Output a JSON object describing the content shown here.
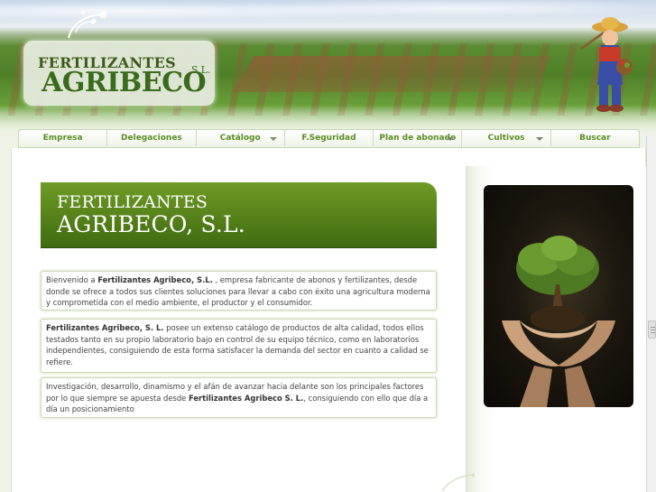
{
  "brand": {
    "logo_line1": "FERTILIZANTES",
    "logo_line2": "AGRIBECO",
    "logo_suffix": "S.L."
  },
  "nav": {
    "items": [
      {
        "label": "Empresa",
        "has_dropdown": false
      },
      {
        "label": "Delegaciones",
        "has_dropdown": false
      },
      {
        "label": "Catálogo",
        "has_dropdown": true
      },
      {
        "label": "F.Seguridad",
        "has_dropdown": false
      },
      {
        "label": "Plan de abonado",
        "has_dropdown": true
      },
      {
        "label": "Cultivos",
        "has_dropdown": true
      },
      {
        "label": "Buscar",
        "has_dropdown": false
      }
    ]
  },
  "main": {
    "title_line1": "FERTILIZANTES",
    "title_line2": "AGRIBECO, S.L.",
    "paragraphs": [
      {
        "pre": "Bienvenido a ",
        "bold": "Fertilizantes Agribeco, S.L.",
        "post": " , empresa fabricante de abonos y fertilizantes, desde donde se ofrece a todos sus clientes soluciones para llevar a cabo con éxito una agricultura moderna y comprometida con el medio ambiente, el productor y el consumidor."
      },
      {
        "pre": "",
        "bold": "Fertilizantes Agribeco, S. L.",
        "post": " posee un extenso catálogo de productos de alta calidad, todos ellos testados tanto en su propio laboratorio bajo en control de su equipo técnico, como en laboratorios independientes, consiguiendo de esta forma satisfacer la demanda del sector en cuanto a calidad se refiere."
      },
      {
        "pre": "Investigación, desarrollo, dinamismo y el afán de avanzar hacia delante son los principales factores por lo que siempre se apuesta desde ",
        "bold": "Fertilizantes Agribeco S. L.",
        "post": ", consiguiendo con ello que día a día un posicionamiento"
      }
    ]
  },
  "colors": {
    "accent_green": "#5b8d24",
    "title_panel": "#5a861c",
    "page_background": "#eef3e6"
  },
  "icons": {
    "dropdown": "caret-down-icon",
    "logo_ornament": "leaf-swirl-icon",
    "mascot": "farmer-mascot-icon",
    "photo": "hands-holding-tree-photo"
  }
}
